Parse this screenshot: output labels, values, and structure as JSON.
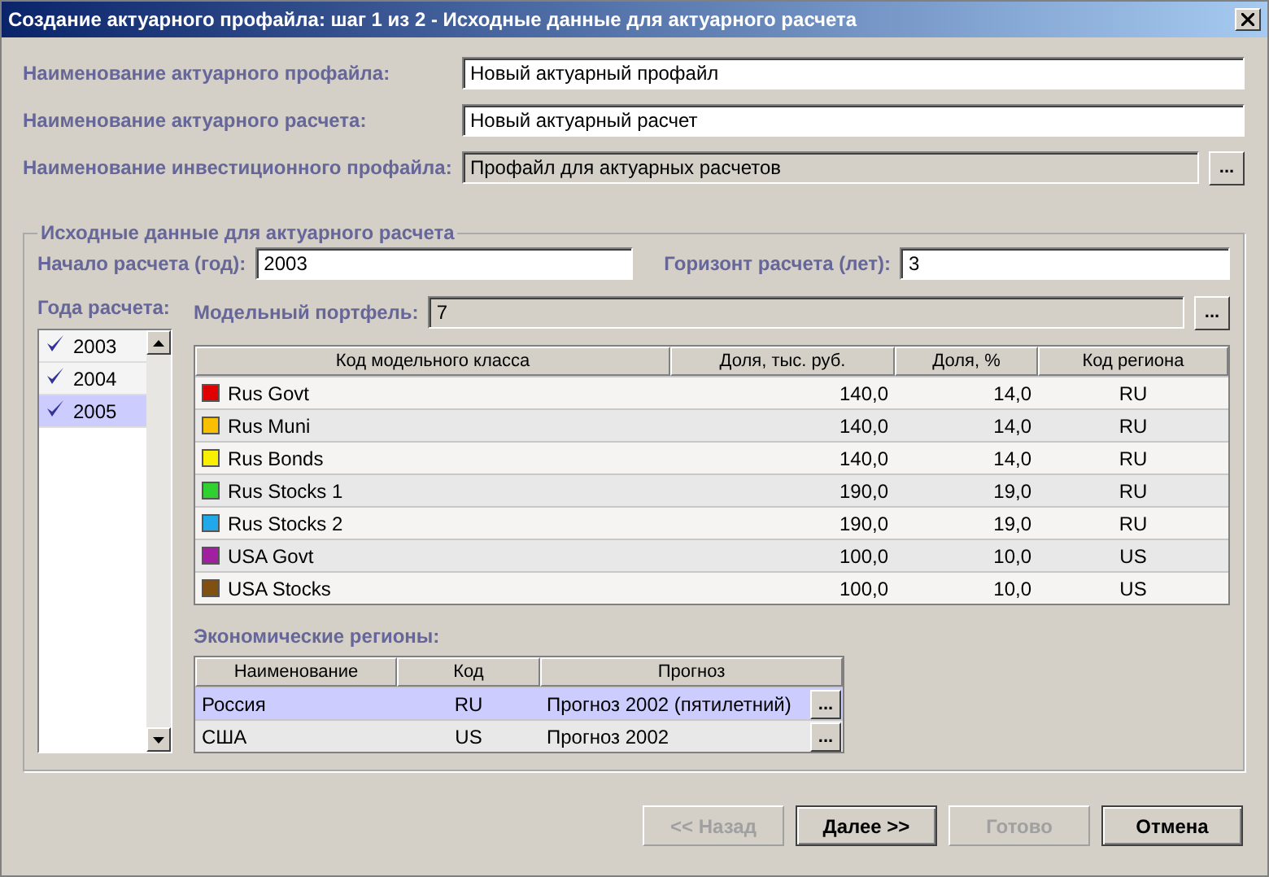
{
  "window": {
    "title": "Создание актуарного профайла: шаг 1 из 2 - Исходные данные для актуарного расчета"
  },
  "fields": [
    {
      "label": "Наименование актуарного профайла:",
      "value": "Новый актуарный профайл",
      "disabled": false
    },
    {
      "label": "Наименование актуарного расчета:",
      "value": "Новый актуарный расчет",
      "disabled": false
    },
    {
      "label": "Наименование инвестиционного профайла:",
      "value": "Профайл для актуарных расчетов",
      "disabled": true,
      "browse_label": "..."
    }
  ],
  "group": {
    "title": "Исходные данные для актуарного расчета",
    "start": {
      "label": "Начало расчета (год):",
      "value": "2003"
    },
    "horizon": {
      "label": "Горизонт расчета (лет):",
      "value": "3"
    },
    "years_label": "Года расчета:",
    "years": [
      {
        "label": "2003",
        "checked": true,
        "selected": false
      },
      {
        "label": "2004",
        "checked": true,
        "selected": false
      },
      {
        "label": "2005",
        "checked": true,
        "selected": true
      }
    ],
    "portfolio": {
      "label": "Модельный портфель:",
      "value": "7",
      "browse_label": "..."
    },
    "table": {
      "columns": [
        "Код модельного класса",
        "Доля, тыс. руб.",
        "Доля, %",
        "Код региона"
      ],
      "rows": [
        {
          "name": "Rus Govt",
          "color": "#e00000",
          "amount": "140,0",
          "percent": "14,0",
          "region": "RU"
        },
        {
          "name": "Rus Muni",
          "color": "#f8c000",
          "amount": "140,0",
          "percent": "14,0",
          "region": "RU"
        },
        {
          "name": "Rus Bonds",
          "color": "#f8f000",
          "amount": "140,0",
          "percent": "14,0",
          "region": "RU"
        },
        {
          "name": "Rus Stocks 1",
          "color": "#30d030",
          "amount": "190,0",
          "percent": "19,0",
          "region": "RU"
        },
        {
          "name": "Rus Stocks 2",
          "color": "#20a8e8",
          "amount": "190,0",
          "percent": "19,0",
          "region": "RU"
        },
        {
          "name": "USA Govt",
          "color": "#a020a0",
          "amount": "100,0",
          "percent": "10,0",
          "region": "US"
        },
        {
          "name": "USA Stocks",
          "color": "#805010",
          "amount": "100,0",
          "percent": "10,0",
          "region": "US"
        }
      ]
    },
    "regions_label": "Экономические регионы:",
    "regions": {
      "columns": [
        "Наименование",
        "Код",
        "Прогноз"
      ],
      "rows": [
        {
          "name": "Россия",
          "code": "RU",
          "forecast": "Прогноз 2002 (пятилетний)",
          "browse_label": "...",
          "selected": true
        },
        {
          "name": "США",
          "code": "US",
          "forecast": "Прогноз 2002",
          "browse_label": "...",
          "selected": false
        }
      ]
    }
  },
  "buttons": [
    {
      "label": "<< Назад",
      "disabled": true
    },
    {
      "label": "Далее >>",
      "disabled": false
    },
    {
      "label": "Готово",
      "disabled": true
    },
    {
      "label": "Отмена",
      "disabled": false
    }
  ]
}
